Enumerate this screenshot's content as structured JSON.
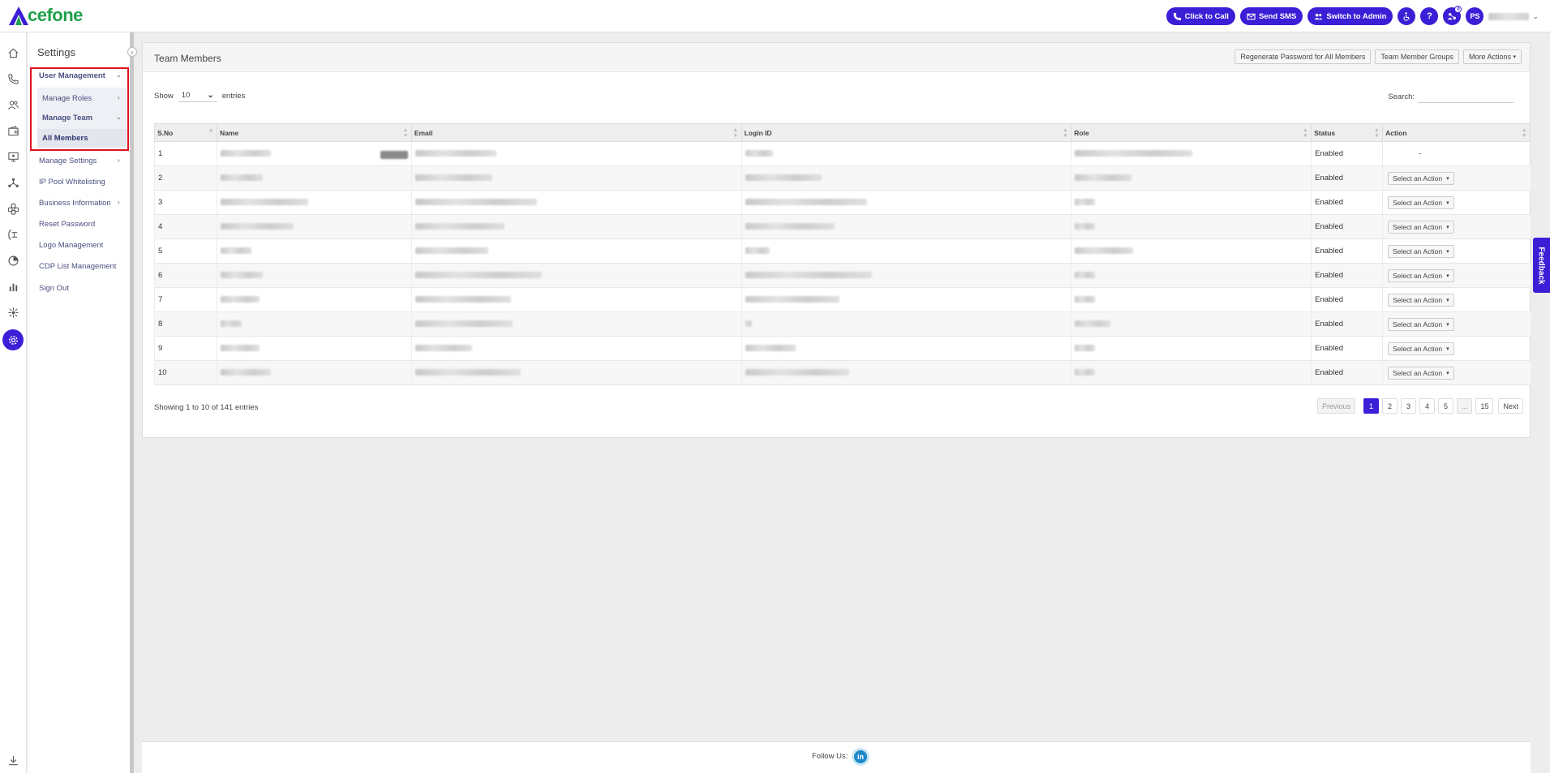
{
  "brand": {
    "logo_text": "cefone",
    "logo_alt": "Acefone"
  },
  "topbar": {
    "click_to_call": "Click to Call",
    "send_sms": "Send SMS",
    "switch_admin": "Switch to Admin",
    "help": "?",
    "notif_count": "0",
    "user_initials": "PS",
    "accent": "#3a1fd6"
  },
  "sidebar": {
    "title": "Settings",
    "user_management": "User Management",
    "manage_roles": "Manage Roles",
    "manage_team": "Manage Team",
    "all_members": "All Members",
    "manage_settings": "Manage Settings",
    "ip_pool": "IP Pool Whitelisting",
    "business_info": "Business Information",
    "reset_password": "Reset Password",
    "logo_management": "Logo Management",
    "cdp_list": "CDP List Management",
    "sign_out": "Sign Out"
  },
  "rail_icons": [
    "home-icon",
    "phone-icon",
    "contacts-icon",
    "wallet-icon",
    "monitor-icon",
    "network-icon",
    "integrations-icon",
    "call-flow-icon",
    "reports-icon",
    "analytics-icon",
    "automation-icon",
    "settings-icon",
    "download-icon"
  ],
  "panel": {
    "title": "Team Members",
    "regen_btn": "Regenerate Password for All Members",
    "groups_btn": "Team Member Groups",
    "more_btn": "More Actions",
    "show_label": "Show",
    "entries_label": "entries",
    "page_size": "10",
    "search_label": "Search:",
    "columns": [
      "S.No",
      "Name",
      "Email",
      "Login ID",
      "Role",
      "Status",
      "Action"
    ],
    "rows": [
      {
        "sno": "1",
        "status": "Enabled",
        "action": "-"
      },
      {
        "sno": "2",
        "status": "Enabled",
        "action": "Select an Action"
      },
      {
        "sno": "3",
        "status": "Enabled",
        "action": "Select an Action"
      },
      {
        "sno": "4",
        "status": "Enabled",
        "action": "Select an Action"
      },
      {
        "sno": "5",
        "status": "Enabled",
        "action": "Select an Action"
      },
      {
        "sno": "6",
        "status": "Enabled",
        "action": "Select an Action"
      },
      {
        "sno": "7",
        "status": "Enabled",
        "action": "Select an Action"
      },
      {
        "sno": "8",
        "status": "Enabled",
        "action": "Select an Action"
      },
      {
        "sno": "9",
        "status": "Enabled",
        "action": "Select an Action"
      },
      {
        "sno": "10",
        "status": "Enabled",
        "action": "Select an Action"
      }
    ],
    "info": "Showing 1 to 10 of 141 entries",
    "pager": {
      "prev": "Previous",
      "pages": [
        "1",
        "2",
        "3",
        "4",
        "5",
        "...",
        "15"
      ],
      "next": "Next",
      "current": "1"
    }
  },
  "footer": {
    "follow": "Follow Us:",
    "linkedin": "in"
  },
  "feedback": "Feedback"
}
